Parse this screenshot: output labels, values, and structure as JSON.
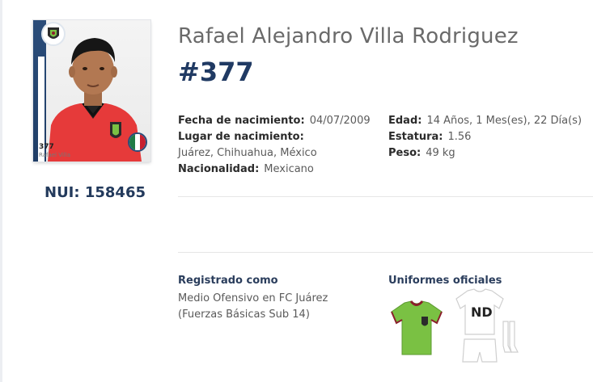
{
  "player": {
    "full_name": "Rafael Alejandro Villa Rodriguez",
    "number": "#377",
    "nui_label": "NUI: 158465"
  },
  "card": {
    "number": "377",
    "name": "Rafael Villa"
  },
  "details": {
    "birth_date": {
      "label": "Fecha de nacimiento:",
      "value": "04/07/2009"
    },
    "birth_place": {
      "label": "Lugar de nacimiento:",
      "value": "Juárez, Chihuahua, México"
    },
    "nationality": {
      "label": "Nacionalidad:",
      "value": "Mexicano"
    },
    "age": {
      "label": "Edad:",
      "value": "14 Años, 1 Mes(es), 22 Día(s)"
    },
    "height": {
      "label": "Estatura:",
      "value": "1.56"
    },
    "weight": {
      "label": "Peso:",
      "value": "49 kg"
    }
  },
  "registration": {
    "title": "Registrado como",
    "line1": "Medio Ofensivo en FC Juárez",
    "line2": "(Fuerzas Básicas Sub 14)"
  },
  "uniforms": {
    "title": "Uniformes oficiales",
    "away_label": "ND"
  },
  "colors": {
    "navy": "#203a63",
    "home_kit": "#7ac143",
    "home_trim": "#8a1f2b",
    "away_kit": "#ffffff"
  },
  "icons": {
    "club_badge": "club-badge-icon",
    "nationality_flag": "mexico-flag-icon"
  }
}
